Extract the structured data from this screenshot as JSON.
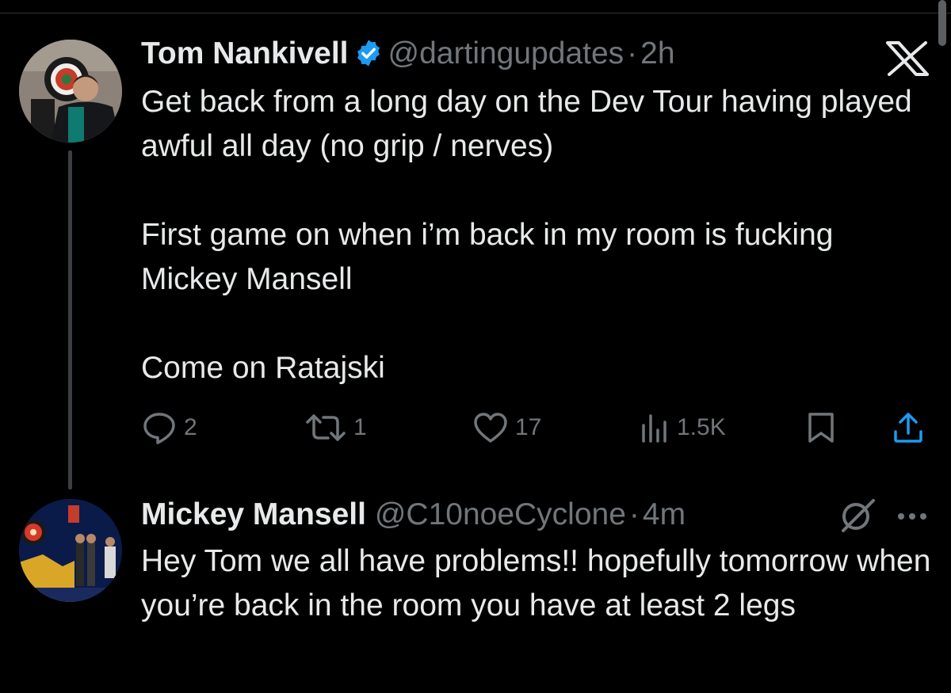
{
  "tweet": {
    "name": "Tom Nankivell",
    "handle": "@dartingupdates",
    "separator": "·",
    "time": "2h",
    "paragraphs": [
      "Get back from a long day on the Dev Tour having played awful all day (no grip / nerves)",
      "First game on when i’m back in my room is fucking Mickey Mansell",
      "Come on Ratajski"
    ],
    "verified": true,
    "actions": {
      "replies": "2",
      "reposts": "1",
      "likes": "17",
      "views": "1.5K"
    }
  },
  "reply": {
    "name": "Mickey Mansell",
    "handle": "@C10noeCyclone",
    "separator": "·",
    "time": "4m",
    "text": "Hey Tom we all have problems!! hopefully tomorrow when you’re back in the room you have at least 2 legs"
  },
  "icons": {
    "brand": "x-logo",
    "verified": "verified-badge-icon",
    "reply": "reply-icon",
    "repost": "repost-icon",
    "like": "heart-icon",
    "views": "views-icon",
    "bookmark": "bookmark-icon",
    "share": "share-icon",
    "grok": "grok-icon",
    "more": "more-icon"
  },
  "colors": {
    "background": "#000000",
    "text": "#e7e9ea",
    "muted": "#71767b",
    "verified": "#1d9bf0",
    "accent": "#1d9bf0"
  }
}
